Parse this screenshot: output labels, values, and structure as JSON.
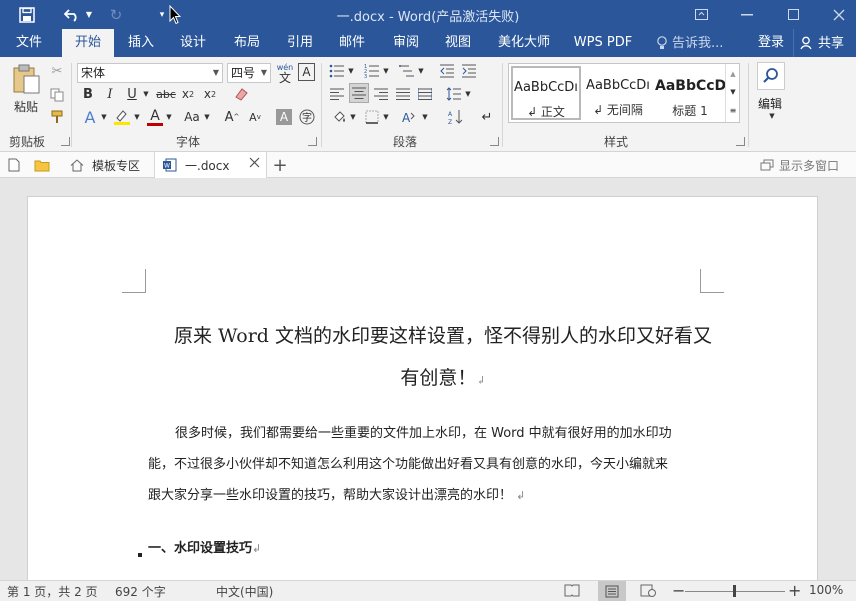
{
  "titlebar": {
    "title": "一.docx - Word(产品激活失败)"
  },
  "tabs": [
    {
      "label": "文件"
    },
    {
      "label": "开始"
    },
    {
      "label": "插入"
    },
    {
      "label": "设计"
    },
    {
      "label": "布局"
    },
    {
      "label": "引用"
    },
    {
      "label": "邮件"
    },
    {
      "label": "审阅"
    },
    {
      "label": "视图"
    },
    {
      "label": "美化大师"
    },
    {
      "label": "WPS PDF"
    }
  ],
  "tell_me": "告诉我...",
  "login": "登录",
  "share": "共享",
  "ribbon": {
    "clipboard": {
      "paste": "粘贴",
      "label": "剪贴板"
    },
    "font": {
      "name": "宋体",
      "size": "四号",
      "label": "字体",
      "wen": "wén",
      "wen_char": "文"
    },
    "paragraph": {
      "label": "段落"
    },
    "styles": {
      "label": "样式",
      "items": [
        {
          "preview": "AaBbCcDı",
          "name": "↲ 正文"
        },
        {
          "preview": "AaBbCcDı",
          "name": "↲ 无间隔"
        },
        {
          "preview": "AaBbCcD",
          "name": "标题 1"
        }
      ]
    },
    "editing": {
      "label": "编辑"
    }
  },
  "doctabs": {
    "template": "模板专区",
    "document": "一.docx",
    "multi_window": "显示多窗口"
  },
  "document": {
    "title_line1": "原来 Word 文档的水印要这样设置，怪不得别人的水印又好看又",
    "title_line2": "有创意！",
    "para_line1": "很多时候，我们都需要给一些重要的文件加上水印，在 Word 中就有很好用的加水印功",
    "para_line2": "能，不过很多小伙伴却不知道怎么利用这个功能做出好看又具有创意的水印，今天小编就来",
    "para_line3": "跟大家分享一些水印设置的技巧，帮助大家设计出漂亮的水印！",
    "heading1": "一、水印设置技巧",
    "para_mark": "↲"
  },
  "status": {
    "page": "第 1 页，共 2 页",
    "words": "692 个字",
    "language": "中文(中国)",
    "zoom": "100%",
    "zoom_level": 100
  }
}
